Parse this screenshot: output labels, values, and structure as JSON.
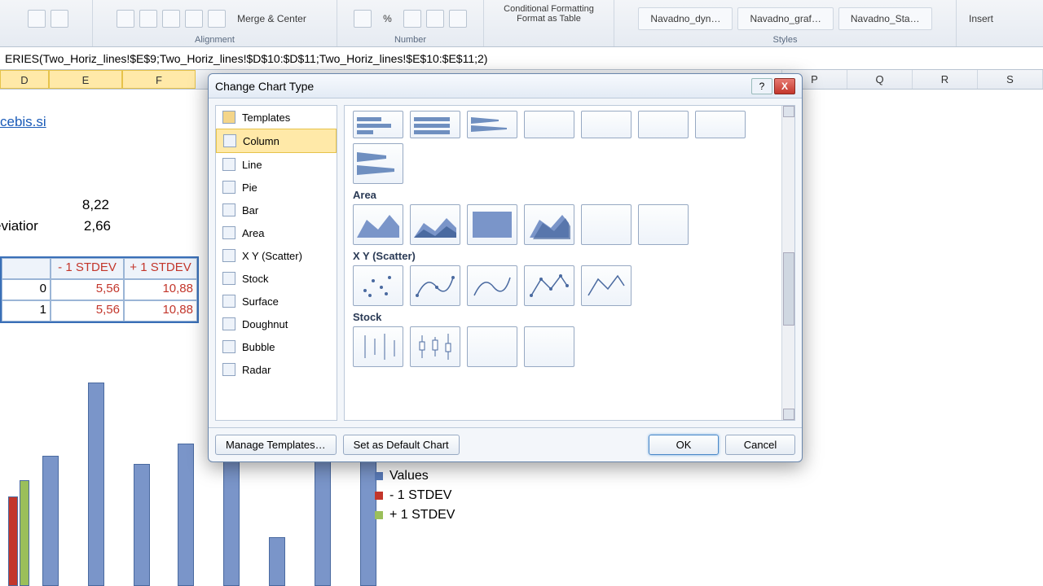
{
  "ribbon": {
    "merge": "Merge & Center",
    "alignment_label": "Alignment",
    "number_label": "Number",
    "cond_fmt": "Conditional Formatting",
    "fmt_table": "Format as Table",
    "styles_label": "Styles",
    "style1": "Navadno_dyn…",
    "style2": "Navadno_graf…",
    "style3": "Navadno_Sta…",
    "insert": "Insert"
  },
  "formula": "ERIES(Two_Horiz_lines!$E$9;Two_Horiz_lines!$D$10:$D$11;Two_Horiz_lines!$E$10:$E$11;2)",
  "cols": [
    "D",
    "E",
    "F",
    "",
    "",
    "",
    "",
    "",
    "",
    "",
    "",
    "",
    "P",
    "Q",
    "R",
    "S"
  ],
  "sheet": {
    "link": "cebis.si",
    "val1": "8,22",
    "row2_label": "eviatior",
    "val2": "2,66",
    "table": {
      "h1": "- 1 STDEV",
      "h2": "+ 1 STDEV",
      "r1c0": "0",
      "r1c1": "5,56",
      "r1c2": "10,88",
      "r2c0": "1",
      "r2c1": "5,56",
      "r2c2": "10,88"
    }
  },
  "legend": {
    "l1": "Values",
    "l2": "- 1 STDEV",
    "l3": "+ 1 STDEV"
  },
  "dialog": {
    "title": "Change Chart Type",
    "categories": [
      "Templates",
      "Column",
      "Line",
      "Pie",
      "Bar",
      "Area",
      "X Y (Scatter)",
      "Stock",
      "Surface",
      "Doughnut",
      "Bubble",
      "Radar"
    ],
    "selected_cat": "Column",
    "sect_area": "Area",
    "sect_scatter": "X Y (Scatter)",
    "sect_stock": "Stock",
    "manage": "Manage Templates…",
    "set_default": "Set as Default Chart",
    "ok": "OK",
    "cancel": "Cancel"
  },
  "percent_sym": "%"
}
